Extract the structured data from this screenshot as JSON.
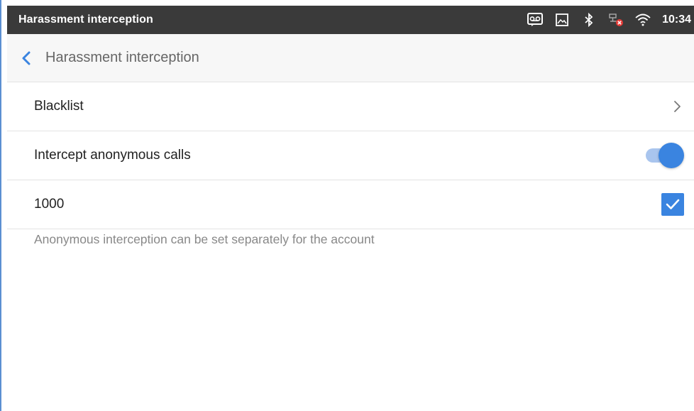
{
  "status_bar": {
    "app_title": "Harassment interception",
    "time": "10:34",
    "icons": [
      "voicemail-icon",
      "image-icon",
      "bluetooth-icon",
      "network-error-icon",
      "wifi-icon"
    ]
  },
  "header": {
    "back_icon": "chevron-left-icon",
    "title": "Harassment interception"
  },
  "settings": {
    "blacklist": {
      "label": "Blacklist",
      "icon": "chevron-right-icon"
    },
    "intercept_anonymous": {
      "label": "Intercept anonymous calls",
      "enabled": true
    },
    "account": {
      "label": "1000",
      "checked": true
    },
    "hint": "Anonymous interception can be set separately for the account"
  },
  "colors": {
    "accent": "#3a84e0",
    "status_bar_bg": "#3a3a3a",
    "header_bg": "#f7f7f7"
  }
}
